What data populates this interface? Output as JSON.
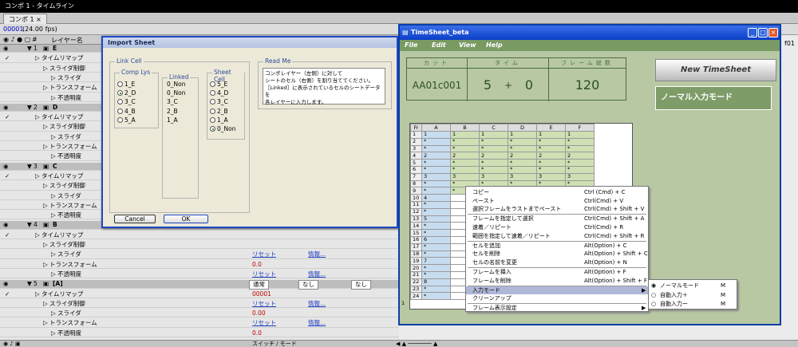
{
  "ae": {
    "title": "コンポ 1 - タイムライン",
    "comp_tab": "コンポ 1 ×",
    "timecode": "00001",
    "fps": "(24.00 fps)",
    "col_layer_name": "レイヤー名",
    "col_hash": "#",
    "switch_mode": "スイッチ / モード",
    "right_edge_label": "f01"
  },
  "layers": [
    {
      "kind": "layer",
      "num": "1",
      "name": "E"
    },
    {
      "kind": "prop",
      "indent": 1,
      "name": "タイムリマップ"
    },
    {
      "kind": "prop",
      "indent": 2,
      "name": "スライダ制御"
    },
    {
      "kind": "prop",
      "indent": 3,
      "name": "スライダ"
    },
    {
      "kind": "prop",
      "indent": 2,
      "name": "トランスフォーム"
    },
    {
      "kind": "prop",
      "indent": 3,
      "name": "不透明度"
    },
    {
      "kind": "layer",
      "num": "2",
      "name": "D"
    },
    {
      "kind": "prop",
      "indent": 1,
      "name": "タイムリマップ"
    },
    {
      "kind": "prop",
      "indent": 2,
      "name": "スライダ制御"
    },
    {
      "kind": "prop",
      "indent": 3,
      "name": "スライダ"
    },
    {
      "kind": "prop",
      "indent": 2,
      "name": "トランスフォーム"
    },
    {
      "kind": "prop",
      "indent": 3,
      "name": "不透明度"
    },
    {
      "kind": "layer",
      "num": "3",
      "name": "C"
    },
    {
      "kind": "prop",
      "indent": 1,
      "name": "タイムリマップ"
    },
    {
      "kind": "prop",
      "indent": 2,
      "name": "スライダ制御"
    },
    {
      "kind": "prop",
      "indent": 3,
      "name": "スライダ"
    },
    {
      "kind": "prop",
      "indent": 2,
      "name": "トランスフォーム"
    },
    {
      "kind": "prop",
      "indent": 3,
      "name": "不透明度"
    },
    {
      "kind": "layer",
      "num": "4",
      "name": "B"
    },
    {
      "kind": "prop",
      "indent": 1,
      "name": "タイムリマップ"
    },
    {
      "kind": "prop",
      "indent": 2,
      "name": "スライダ制御"
    },
    {
      "kind": "prop",
      "indent": 3,
      "name": "スライダ",
      "reset": "リセット",
      "info": "情報..."
    },
    {
      "kind": "prop",
      "indent": 2,
      "name": "トランスフォーム",
      "value": "0.0"
    },
    {
      "kind": "prop",
      "indent": 3,
      "name": "不透明度",
      "reset": "リセット",
      "info": "情報..."
    },
    {
      "kind": "layer",
      "num": "5",
      "name": "[A]",
      "mode": "通常",
      "trkmat": "なし",
      "parent": "なし"
    },
    {
      "kind": "prop",
      "indent": 1,
      "name": "タイムリマップ",
      "value": "00001"
    },
    {
      "kind": "prop",
      "indent": 2,
      "name": "スライダ制御",
      "reset": "リセット",
      "info": "情報..."
    },
    {
      "kind": "prop",
      "indent": 3,
      "name": "スライダ",
      "value": "0.00"
    },
    {
      "kind": "prop",
      "indent": 2,
      "name": "トランスフォーム",
      "reset": "リセット",
      "info": "情報..."
    },
    {
      "kind": "prop",
      "indent": 3,
      "name": "不透明度",
      "value": "0.0"
    }
  ],
  "import": {
    "title": "Import Sheet",
    "link_cell": "Link Cell",
    "comp_lys": "Comp Lys",
    "linked": "Linked",
    "sheet_cell": "Sheet Cell",
    "read_me": "Read Me",
    "comp_items": [
      "1_E",
      "2_D",
      "3_C",
      "4_B",
      "5_A"
    ],
    "comp_selected": 1,
    "linked_items": [
      "0_Non",
      "0_Non",
      "3_C",
      "2_B",
      "1_A"
    ],
    "sheet_items": [
      "5_E",
      "4_D",
      "3_C",
      "2_B",
      "1_A",
      "0_Non"
    ],
    "sheet_selected": 5,
    "readme_lines": [
      "コンポレイヤー（左側）に対して",
      "シートのセル（右側）を割り当ててください。",
      "［Linked］に表示されているセルのシートデータを",
      "各レイヤーに入力します。"
    ],
    "cancel": "Cancel",
    "ok": "OK"
  },
  "timesheet": {
    "title": "TimeSheet_beta",
    "menu": [
      "File",
      "Edit",
      "View",
      "Help"
    ],
    "cut_label": "カット",
    "time_label": "タイム",
    "frames_label": "フレーム総数",
    "cut_value": "AA01c001",
    "sec_value": "5",
    "plus": "+",
    "frame_value": "0",
    "total_frames": "120",
    "new_button": "New TimeSheet",
    "mode_label": "ノーマル入力モード",
    "grid_headers": [
      "Fr",
      "A",
      "B",
      "C",
      "D",
      "E",
      "F"
    ],
    "grid_rows": [
      [
        "1",
        "1",
        "1",
        "1",
        "1",
        "1",
        "1"
      ],
      [
        "2",
        "*",
        "*",
        "*",
        "*",
        "*",
        "*"
      ],
      [
        "3",
        "*",
        "*",
        "*",
        "*",
        "*",
        "*"
      ],
      [
        "4",
        "2",
        "2",
        "2",
        "2",
        "2",
        "2"
      ],
      [
        "5",
        "*",
        "*",
        "*",
        "*",
        "*",
        "*"
      ],
      [
        "6",
        "*",
        "*",
        "*",
        "*",
        "*",
        "*"
      ],
      [
        "7",
        "3",
        "3",
        "3",
        "3",
        "3",
        "3"
      ],
      [
        "8",
        "*",
        "*",
        "*",
        "*",
        "*",
        "*"
      ],
      [
        "9",
        "*",
        "*",
        "*",
        "*",
        "*",
        "*"
      ],
      [
        "10",
        "4",
        "",
        "",
        "",
        "",
        ""
      ],
      [
        "11",
        "*",
        "",
        "",
        "",
        "",
        ""
      ],
      [
        "12",
        "*",
        "",
        "",
        "",
        "",
        ""
      ],
      [
        "13",
        "5",
        "",
        "",
        "",
        "",
        ""
      ],
      [
        "14",
        "*",
        "",
        "",
        "",
        "",
        ""
      ],
      [
        "15",
        "*",
        "",
        "",
        "",
        "",
        ""
      ],
      [
        "16",
        "6",
        "",
        "",
        "",
        "",
        ""
      ],
      [
        "17",
        "*",
        "",
        "",
        "",
        "",
        ""
      ],
      [
        "18",
        "*",
        "",
        "",
        "",
        "",
        ""
      ],
      [
        "19",
        "7",
        "",
        "",
        "",
        "",
        ""
      ],
      [
        "20",
        "*",
        "",
        "",
        "",
        "",
        ""
      ],
      [
        "21",
        "*",
        "",
        "",
        "",
        "",
        ""
      ],
      [
        "22",
        "8",
        "",
        "",
        "",
        "",
        ""
      ],
      [
        "23",
        "*",
        "",
        "",
        "",
        "",
        ""
      ],
      [
        "24",
        "*",
        "",
        "",
        "",
        "",
        ""
      ]
    ],
    "row_marker": "1"
  },
  "context_menu": [
    {
      "label": "コピー",
      "shortcut": "Ctrl (Cmd) + C"
    },
    {
      "label": "ペースト",
      "shortcut": "Ctrl(Cmd) + V"
    },
    {
      "label": "選択フレームをラストまでペースト",
      "shortcut": "Ctrl(Cmd) + Shift + V",
      "sep": true
    },
    {
      "label": "フレームを指定して選択",
      "shortcut": "Ctrl(Cmd) + Shift + A"
    },
    {
      "label": "速着／リピート",
      "shortcut": "Ctrl(Cmd) + R"
    },
    {
      "label": "範囲を指定して速着／リピート",
      "shortcut": "Ctrl(Cmd) + Shift + R",
      "sep": true
    },
    {
      "label": "セルを追加",
      "shortcut": "Alt(Option) + C"
    },
    {
      "label": "セルを削除",
      "shortcut": "Alt(Option) + Shift + C"
    },
    {
      "label": "セルの名前を変更",
      "shortcut": "Alt(Option) + N",
      "sep": true
    },
    {
      "label": "フレームを挿入",
      "shortcut": "Alt(Option) + F"
    },
    {
      "label": "フレームを削除",
      "shortcut": "Alt(Option) + Shift + F",
      "sep": true
    },
    {
      "label": "入力モード",
      "shortcut": "",
      "arrow": "▶",
      "hl": true
    },
    {
      "label": "クリーンアップ",
      "shortcut": "",
      "sep": true
    },
    {
      "label": "フレーム表示設定",
      "shortcut": "",
      "arrow": "▶"
    }
  ],
  "submenu": [
    {
      "label": "ノーマルモード",
      "key": "M",
      "checked": true
    },
    {
      "label": "自動入力＋",
      "key": "M",
      "checked": false
    },
    {
      "label": "自動入力ー",
      "key": "M",
      "checked": false
    }
  ]
}
